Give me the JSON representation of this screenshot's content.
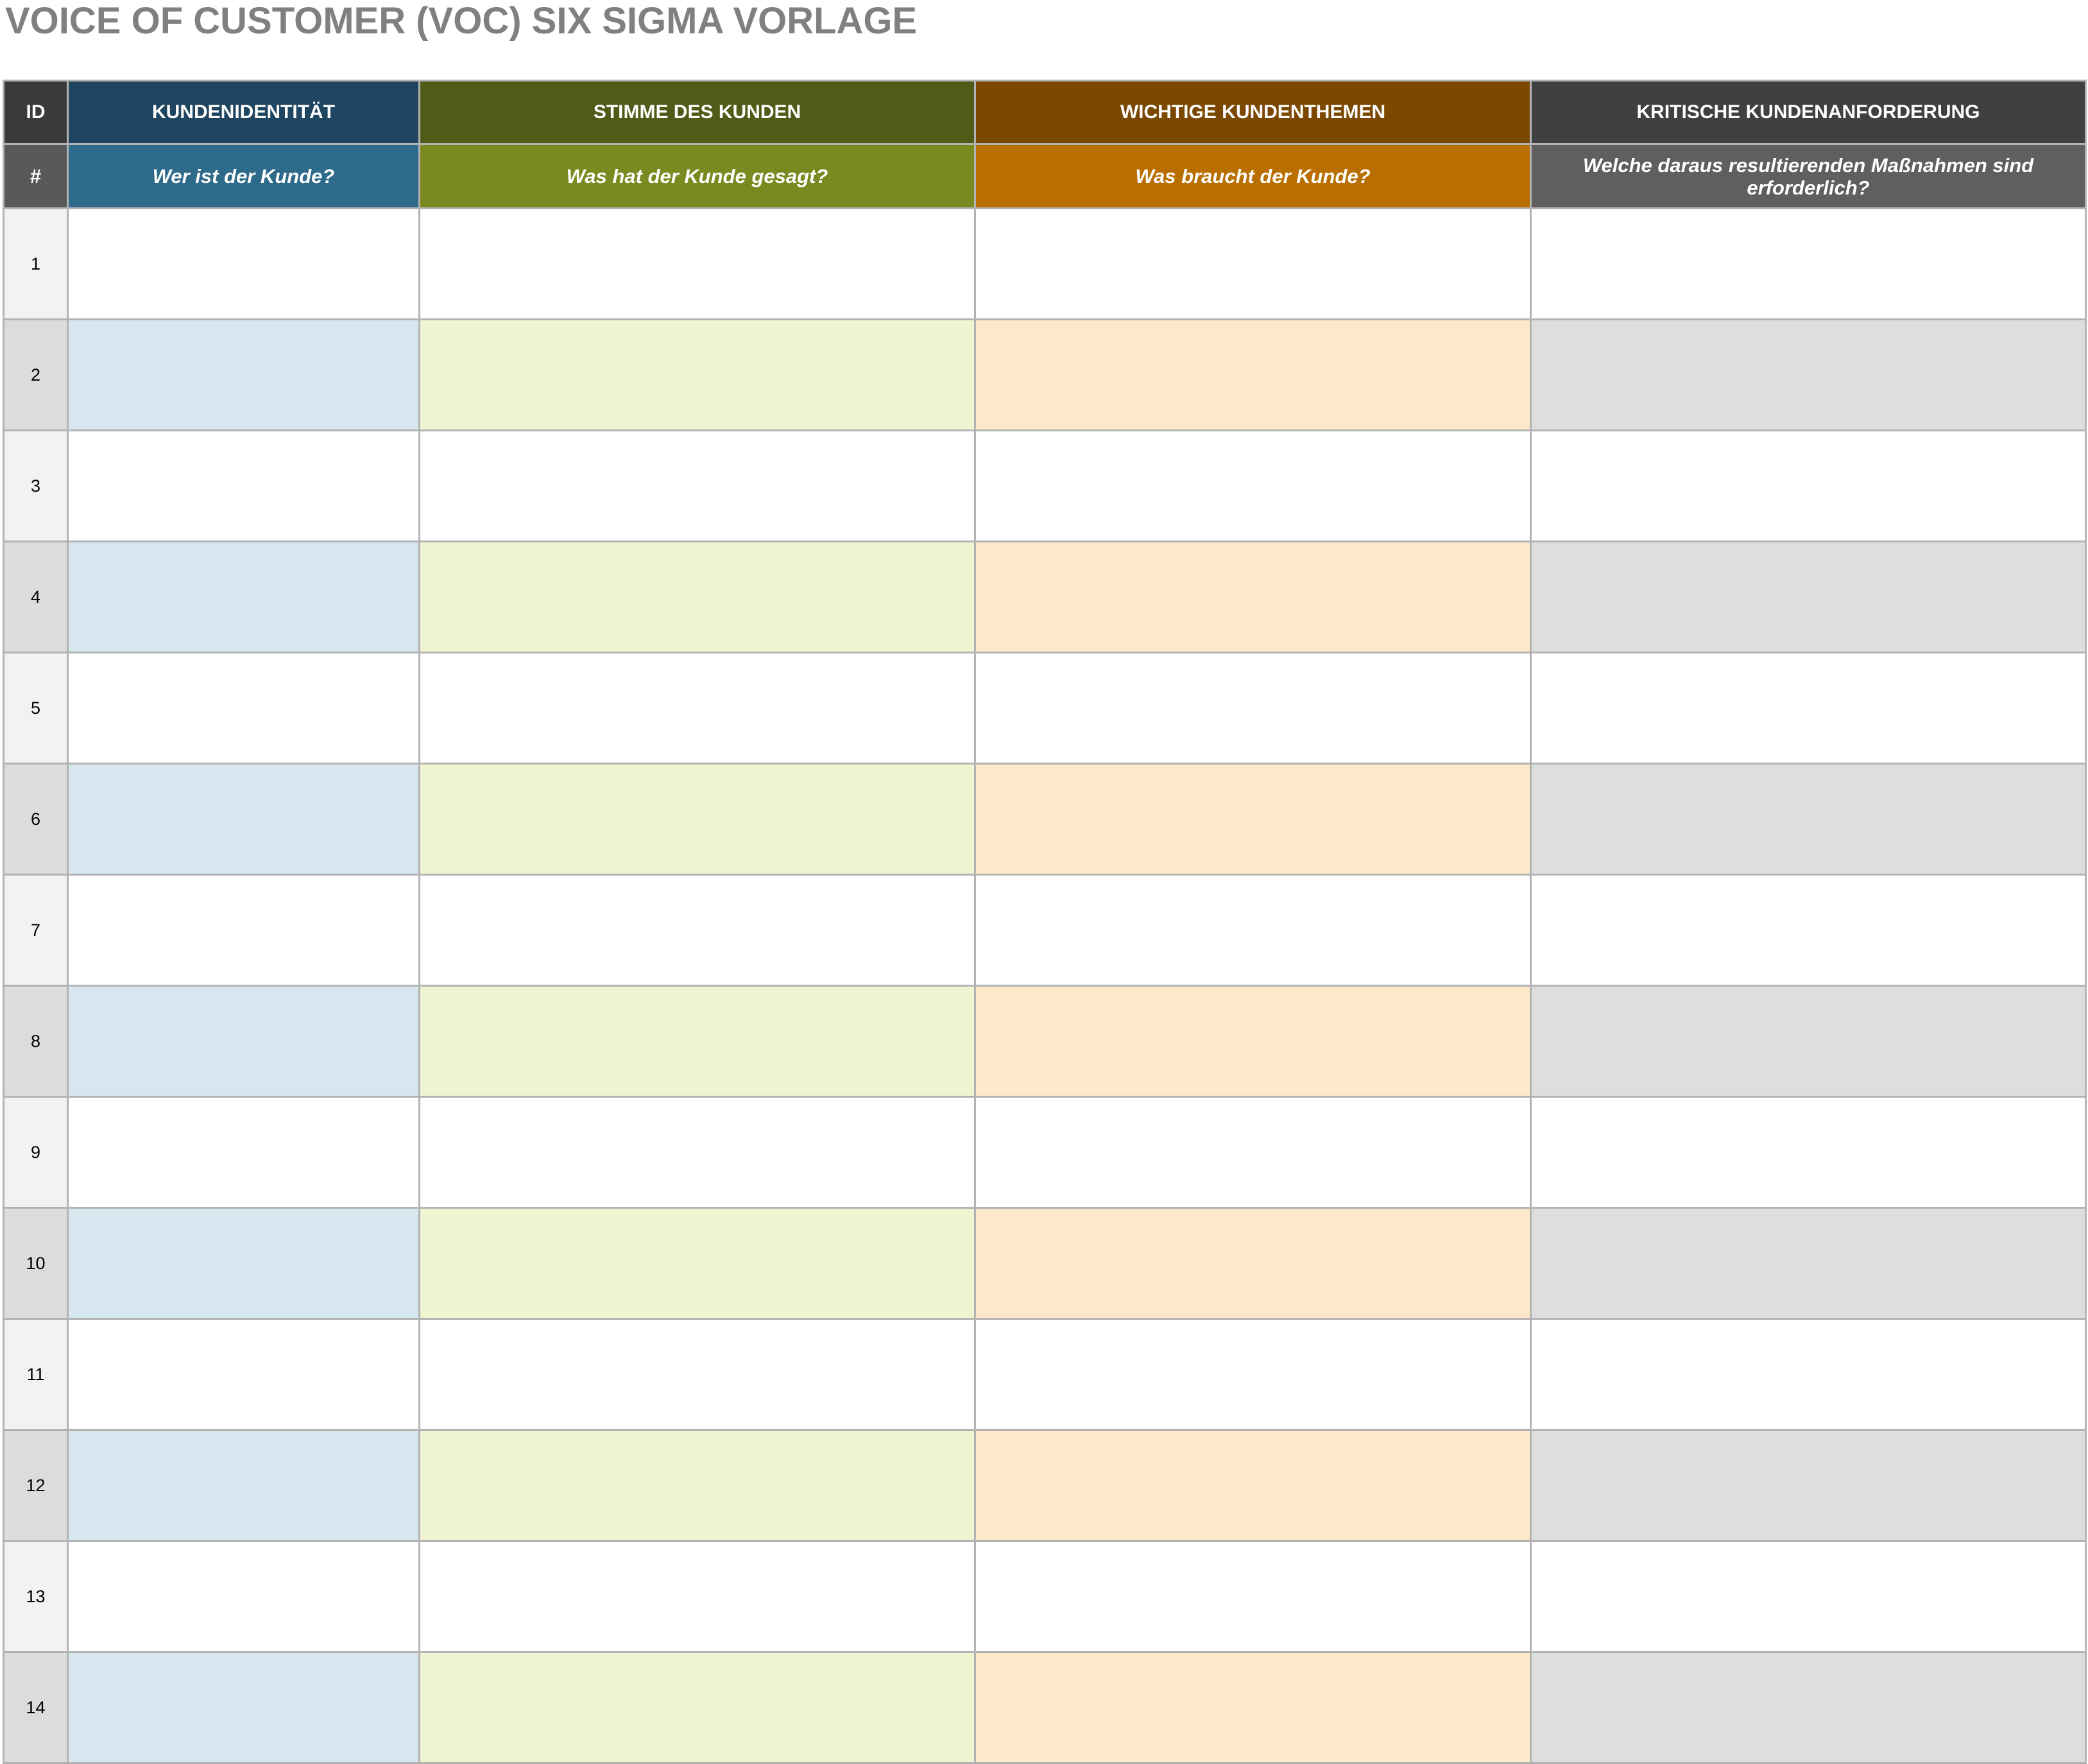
{
  "title": "VOICE OF CUSTOMER (VOC) SIX SIGMA VORLAGE",
  "colors": {
    "id_header": "#3a3a3a",
    "id_sub": "#595959",
    "col1_header": "#1f4560",
    "col1_sub": "#2e6a8a",
    "col2_header": "#4e5c17",
    "col2_sub": "#7a8a20",
    "col3_header": "#7a4800",
    "col3_sub": "#b96e00",
    "col4_header": "#404040",
    "col4_sub": "#5f5f5f"
  },
  "header": {
    "id_label": "ID",
    "hash_label": "#",
    "columns": [
      {
        "title": "KUNDENIDENTITÄT",
        "question": "Wer ist der Kunde?"
      },
      {
        "title": "STIMME DES KUNDEN",
        "question": "Was hat der Kunde gesagt?"
      },
      {
        "title": "WICHTIGE KUNDENTHEMEN",
        "question": "Was braucht der Kunde?"
      },
      {
        "title": "KRITISCHE KUNDENANFORDERUNG",
        "question": "Welche daraus resultierenden Maßnahmen sind erforderlich?"
      }
    ]
  },
  "rows": [
    {
      "id": "1",
      "cells": [
        "",
        "",
        "",
        ""
      ]
    },
    {
      "id": "2",
      "cells": [
        "",
        "",
        "",
        ""
      ]
    },
    {
      "id": "3",
      "cells": [
        "",
        "",
        "",
        ""
      ]
    },
    {
      "id": "4",
      "cells": [
        "",
        "",
        "",
        ""
      ]
    },
    {
      "id": "5",
      "cells": [
        "",
        "",
        "",
        ""
      ]
    },
    {
      "id": "6",
      "cells": [
        "",
        "",
        "",
        ""
      ]
    },
    {
      "id": "7",
      "cells": [
        "",
        "",
        "",
        ""
      ]
    },
    {
      "id": "8",
      "cells": [
        "",
        "",
        "",
        ""
      ]
    },
    {
      "id": "9",
      "cells": [
        "",
        "",
        "",
        ""
      ]
    },
    {
      "id": "10",
      "cells": [
        "",
        "",
        "",
        ""
      ]
    },
    {
      "id": "11",
      "cells": [
        "",
        "",
        "",
        ""
      ]
    },
    {
      "id": "12",
      "cells": [
        "",
        "",
        "",
        ""
      ]
    },
    {
      "id": "13",
      "cells": [
        "",
        "",
        "",
        ""
      ]
    },
    {
      "id": "14",
      "cells": [
        "",
        "",
        "",
        ""
      ]
    }
  ]
}
